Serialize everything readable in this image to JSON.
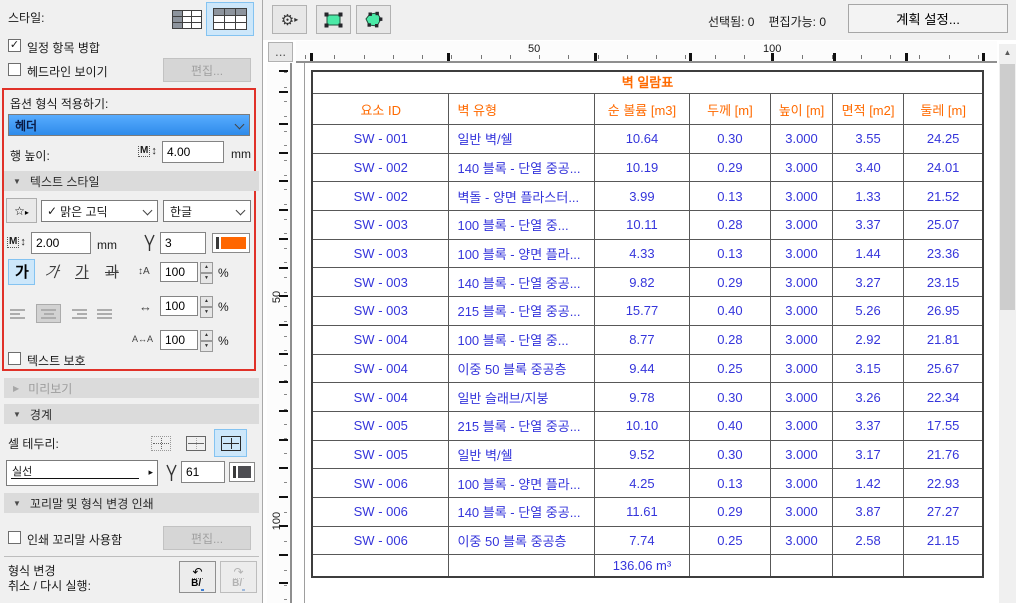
{
  "colors": {
    "accent_orange": "#ff6a00",
    "table_text_blue": "#3535db",
    "pen3_color": "#ff6600",
    "pen61_color": "#4d4d52",
    "green_icon": "#4ae9a6",
    "red_outline": "#e03128",
    "selection_blue": "#2e8beb"
  },
  "icons": {
    "gear": "⚙",
    "flyout_arrow": "▸",
    "star": "☆",
    "updown": "↕",
    "m_letter": "M",
    "chevron_expanded": "▼",
    "chevron_collapsed": "▶",
    "undo": "↶",
    "redo": "↷",
    "collapse_left": "◂",
    "scroll_up": "▲",
    "check": "✓",
    "line_spacing": "↕A",
    "width_factor": "↔",
    "tracking": "A↔A",
    "dots": "..."
  },
  "left_panel": {
    "style_label": "스타일:",
    "checkbox_merge": "일정 항목 병합",
    "checkbox_headline": "헤드라인 보이기",
    "edit_button_label": "편집...",
    "apply_section": {
      "label": "옵션 형식 적용하기:",
      "selected_option": "헤더",
      "row_height_label": "행 높이:",
      "row_height_value": "4.00",
      "row_height_unit": "mm"
    },
    "text_style": {
      "section_title": "텍스트 스타일",
      "font_name": "맑은 고딕",
      "language": "한글",
      "size_value": "2.00",
      "size_unit": "mm",
      "pen_number": "3",
      "bold_label": "가",
      "italic_label": "가",
      "underline_label": "가",
      "strike_label": "과",
      "spin_values": [
        "100",
        "100",
        "100"
      ],
      "percent": "%",
      "protect_checkbox": "텍스트 보호"
    },
    "preview_section": "미리보기",
    "border_section": {
      "title": "경계",
      "cell_border_label": "셀 테두리:",
      "line_type": "실선",
      "pen_number": "61"
    },
    "footer_section": {
      "title": "꼬리말 및 형식 변경 인쇄",
      "print_footer_checkbox": "인쇄 꼬리말 사용함"
    },
    "undo": {
      "line1": "형식 변경",
      "line2": "취소 / 다시 실행:",
      "badge": "B/"
    }
  },
  "toolbar": {
    "selected_count_label": "선택됨: 0",
    "editable_count_label": "편집가능: 0",
    "plan_settings_button": "계획 설정..."
  },
  "rulers": {
    "h_labels": [
      "50",
      "100"
    ],
    "v_labels": [
      "50",
      "100"
    ]
  },
  "schedule": {
    "title": "벽 일람표",
    "columns": [
      "요소 ID",
      "벽 유형",
      "순 볼륨 [m3]",
      "두께 [m]",
      "높이 [m]",
      "면적 [m2]",
      "둘레 [m]"
    ],
    "rows": [
      [
        "SW - 001",
        "일반 벽/쉘",
        "10.64",
        "0.30",
        "3.000",
        "3.55",
        "24.25"
      ],
      [
        "SW - 002",
        "140 블록 - 단열 중공...",
        "10.19",
        "0.29",
        "3.000",
        "3.40",
        "24.01"
      ],
      [
        "SW - 002",
        "벽돌 - 양면 플라스터...",
        "3.99",
        "0.13",
        "3.000",
        "1.33",
        "21.52"
      ],
      [
        "SW - 003",
        "100 블록 - 단열 중...",
        "10.11",
        "0.28",
        "3.000",
        "3.37",
        "25.07"
      ],
      [
        "SW - 003",
        "100 블록 - 양면 플라...",
        "4.33",
        "0.13",
        "3.000",
        "1.44",
        "23.36"
      ],
      [
        "SW - 003",
        "140 블록 - 단열 중공...",
        "9.82",
        "0.29",
        "3.000",
        "3.27",
        "23.15"
      ],
      [
        "SW - 003",
        "215 블록 - 단열 중공...",
        "15.77",
        "0.40",
        "3.000",
        "5.26",
        "26.95"
      ],
      [
        "SW - 004",
        "100 블록 - 단열 중...",
        "8.77",
        "0.28",
        "3.000",
        "2.92",
        "21.81"
      ],
      [
        "SW - 004",
        "이중 50 블록 중공층",
        "9.44",
        "0.25",
        "3.000",
        "3.15",
        "25.67"
      ],
      [
        "SW - 004",
        "일반 슬래브/지붕",
        "9.78",
        "0.30",
        "3.000",
        "3.26",
        "22.34"
      ],
      [
        "SW - 005",
        "215 블록 - 단열 중공...",
        "10.10",
        "0.40",
        "3.000",
        "3.37",
        "17.55"
      ],
      [
        "SW - 005",
        "일반 벽/쉘",
        "9.52",
        "0.30",
        "3.000",
        "3.17",
        "21.76"
      ],
      [
        "SW - 006",
        "100 블록 - 양면 플라...",
        "4.25",
        "0.13",
        "3.000",
        "1.42",
        "22.93"
      ],
      [
        "SW - 006",
        "140 블록 - 단열 중공...",
        "11.61",
        "0.29",
        "3.000",
        "3.87",
        "27.27"
      ],
      [
        "SW - 006",
        "이중 50 블록 중공층",
        "7.74",
        "0.25",
        "3.000",
        "2.58",
        "21.15"
      ]
    ],
    "total_volume": "136.06 m³"
  }
}
